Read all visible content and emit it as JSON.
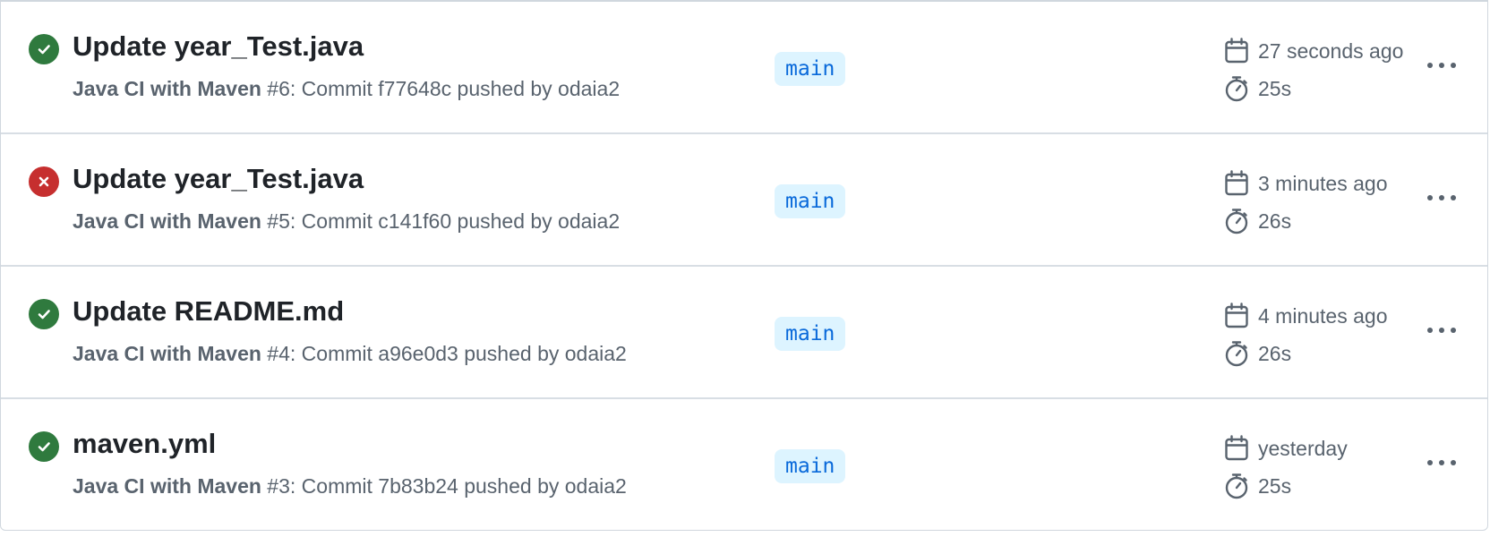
{
  "icons": {
    "success": "check-circle-icon",
    "failure": "x-circle-icon",
    "calendar": "calendar-icon",
    "duration": "stopwatch-icon",
    "more": "kebab-horizontal-icon"
  },
  "colors": {
    "success": "#2f7a3e",
    "failure": "#c62f2f",
    "branch_bg": "#ddf4ff",
    "branch_fg": "#0969da"
  },
  "runs": [
    {
      "status": "success",
      "title": "Update year_Test.java",
      "workflow": "Java CI with Maven",
      "detail": " #6: Commit f77648c pushed by odaia2",
      "branch": "main",
      "when": "27 seconds ago",
      "duration": "25s"
    },
    {
      "status": "failure",
      "title": "Update year_Test.java",
      "workflow": "Java CI with Maven",
      "detail": " #5: Commit c141f60 pushed by odaia2",
      "branch": "main",
      "when": "3 minutes ago",
      "duration": "26s"
    },
    {
      "status": "success",
      "title": "Update README.md",
      "workflow": "Java CI with Maven",
      "detail": " #4: Commit a96e0d3 pushed by odaia2",
      "branch": "main",
      "when": "4 minutes ago",
      "duration": "26s"
    },
    {
      "status": "success",
      "title": "maven.yml",
      "workflow": "Java CI with Maven",
      "detail": " #3: Commit 7b83b24 pushed by odaia2",
      "branch": "main",
      "when": "yesterday",
      "duration": "25s"
    }
  ]
}
